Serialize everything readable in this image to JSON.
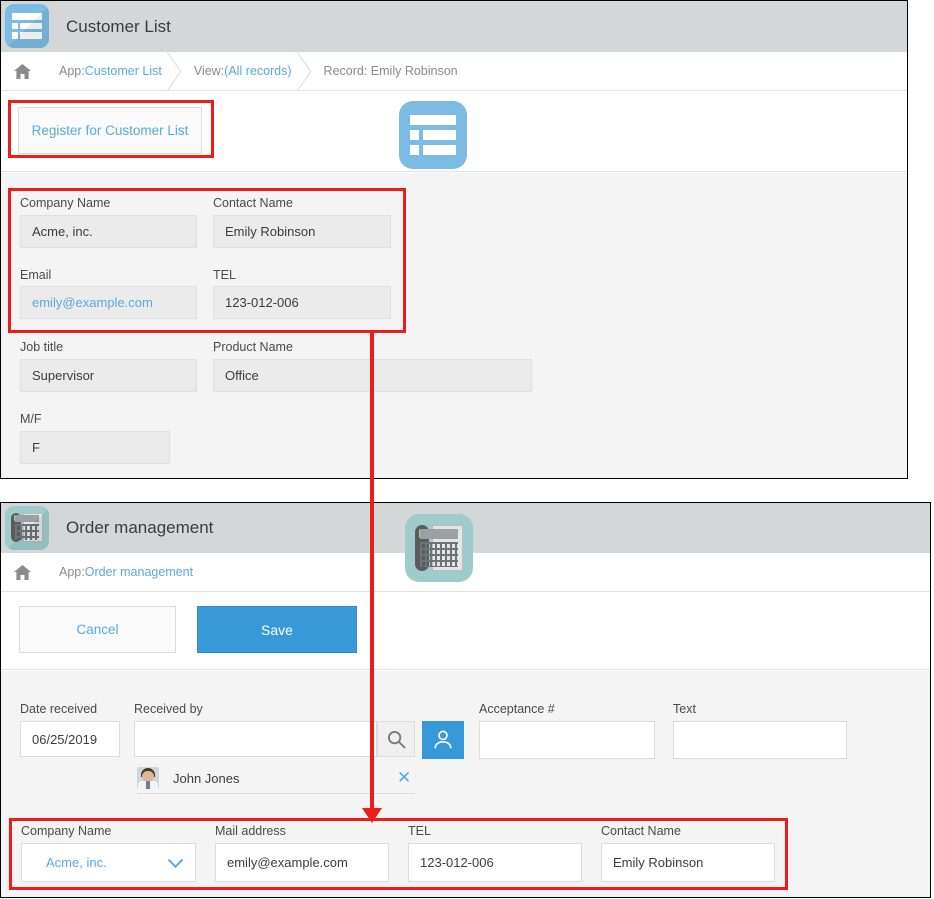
{
  "customer_panel": {
    "header": {
      "title": "Customer List",
      "icon": "list-app-icon"
    },
    "breadcrumb": {
      "home_icon": "home-icon",
      "items": [
        {
          "prefix": "App: ",
          "link": "Customer List"
        },
        {
          "prefix": "View: ",
          "link": "(All records)"
        },
        {
          "prefix": "Record: Emily Robinson",
          "link": ""
        }
      ]
    },
    "register_button": "Register for Customer List",
    "app_icon": "list-app-icon",
    "fields": [
      {
        "label": "Company Name",
        "value": "Acme, inc.",
        "style": "plain"
      },
      {
        "label": "Contact Name",
        "value": "Emily Robinson",
        "style": "plain"
      },
      {
        "label": "Email",
        "value": "emily@example.com",
        "style": "link"
      },
      {
        "label": "TEL",
        "value": "123-012-006",
        "style": "plain"
      },
      {
        "label": "Job title",
        "value": "Supervisor",
        "style": "plain"
      },
      {
        "label": "Product Name",
        "value": "Office",
        "style": "plain"
      },
      {
        "label": "M/F",
        "value": "F",
        "style": "plain"
      }
    ]
  },
  "order_panel": {
    "header": {
      "title": "Order management",
      "icon": "phone-app-icon"
    },
    "breadcrumb": {
      "home_icon": "home-icon",
      "items": [
        {
          "prefix": "App: ",
          "link": "Order management"
        }
      ]
    },
    "app_icon": "phone-app-icon",
    "buttons": {
      "cancel": "Cancel",
      "save": "Save"
    },
    "fields": {
      "date_received": {
        "label": "Date received",
        "value": "06/25/2019"
      },
      "received_by": {
        "label": "Received by",
        "value": "",
        "placeholder": "",
        "search_icon": "search-icon",
        "user_icon": "user-picker-icon",
        "selected": {
          "name": "John Jones",
          "avatar": "user-avatar",
          "remove_icon": "close-icon"
        }
      },
      "acceptance_no": {
        "label": "Acceptance #",
        "value": ""
      },
      "text": {
        "label": "Text",
        "value": ""
      },
      "company_name": {
        "label": "Company Name",
        "value": "Acme, inc.",
        "chevron": "chevron-down-icon"
      },
      "mail_address": {
        "label": "Mail address",
        "value": "emily@example.com"
      },
      "tel": {
        "label": "TEL",
        "value": "123-012-006"
      },
      "contact_name": {
        "label": "Contact Name",
        "value": "Emily Robinson"
      }
    }
  },
  "annotations": {
    "highlight_color": "#ee1c19",
    "accent_color": "#3799d8",
    "link_color": "#5aa9de",
    "header_bg": "#d3d7d8",
    "form_bg": "#f4f4f4"
  }
}
